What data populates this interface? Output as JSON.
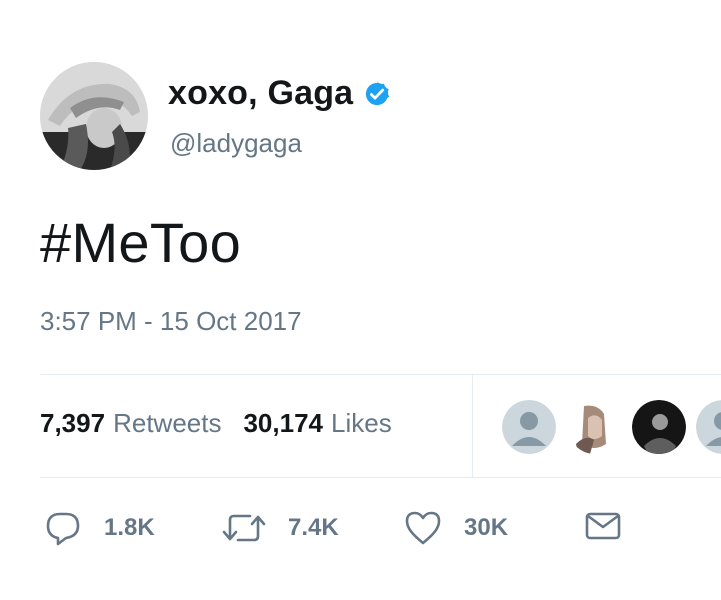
{
  "user": {
    "display_name": "xoxo, Gaga",
    "handle": "@ladygaga",
    "verified": true,
    "avatar": "profile-photo-woman-in-hat"
  },
  "tweet": {
    "text": "#MeToo",
    "timestamp": "3:57 PM - 15 Oct 2017"
  },
  "stats": {
    "retweets_count": "7,397",
    "retweets_label": "Retweets",
    "likes_count": "30,174",
    "likes_label": "Likes"
  },
  "likers": [
    {
      "avatar": "default-avatar"
    },
    {
      "avatar": "photo-avatar"
    },
    {
      "avatar": "dark-photo-avatar"
    },
    {
      "avatar": "default-avatar"
    }
  ],
  "actions": {
    "reply_count": "1.8K",
    "retweet_count": "7.4K",
    "like_count": "30K"
  },
  "colors": {
    "text_primary": "#14171a",
    "text_secondary": "#657786",
    "verified_blue": "#1da1f2",
    "divider": "#e6ecf0"
  }
}
